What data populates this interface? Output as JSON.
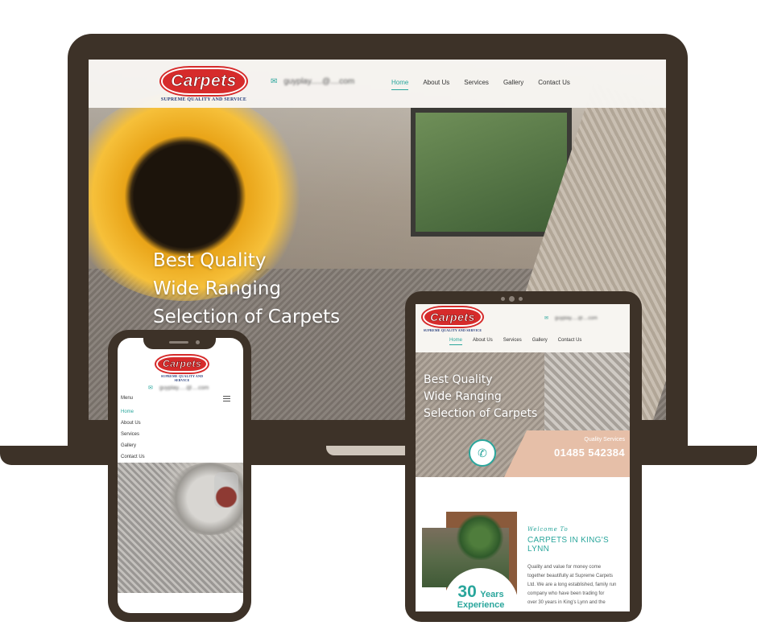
{
  "brand": {
    "logo_text": "Carpets",
    "tagline": "SUPREME QUALITY AND SERVICE"
  },
  "contact": {
    "email": "guyplay.....@....com",
    "phone": "01485 542384"
  },
  "nav": {
    "items": [
      {
        "label": "Home",
        "active": true
      },
      {
        "label": "About Us"
      },
      {
        "label": "Services"
      },
      {
        "label": "Gallery"
      },
      {
        "label": "Contact Us"
      }
    ]
  },
  "mobile_nav": {
    "menu_label": "Menu",
    "items": [
      "Home",
      "About Us",
      "Services",
      "Gallery",
      "Contact Us"
    ]
  },
  "hero": {
    "lines": [
      "Best Quality",
      "Wide Ranging",
      "Selection of Carpets"
    ]
  },
  "quality": {
    "label": "Quality Services",
    "phone": "01485 542384"
  },
  "about": {
    "welcome": "Welcome To",
    "title": "CARPETS IN KING'S LYNN",
    "body_lines": [
      "Quality and value for money come",
      "together beautifully at Supreme Carpets",
      "Ltd. We are a long established, family run",
      "company who have been trading for",
      "over 30 years in King's Lynn and the"
    ],
    "years_number": "30",
    "years_unit": "Years",
    "years_label": "Experience"
  },
  "colors": {
    "accent": "#2aa69c",
    "device_frame": "#3d3228",
    "logo_red": "#d62b2b",
    "quality_box": "#e6bfa8"
  },
  "icons": [
    "mail-icon",
    "hamburger-icon",
    "phone-icon"
  ]
}
